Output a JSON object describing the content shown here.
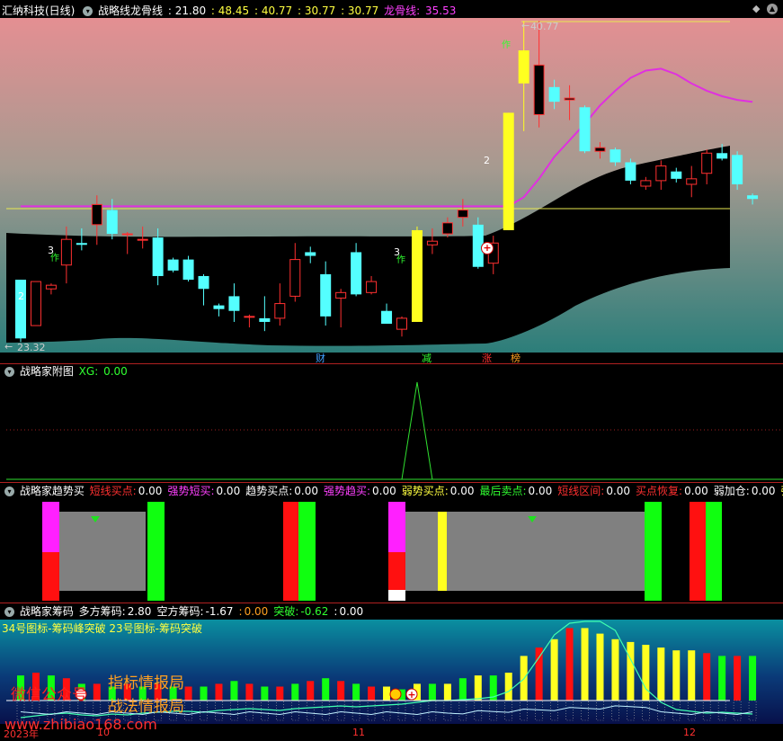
{
  "main": {
    "title": "汇纳科技(日线)",
    "indicator_name": "战略线龙骨线",
    "values": [
      ": 21.80",
      ": 48.45",
      ": 40.77",
      ": 30.77",
      ": 30.77"
    ],
    "dragon_label": "龙骨线:",
    "dragon_value": "35.53",
    "high_label": "40.77",
    "low_label": "23.32",
    "signal_labels": [
      "2",
      "3",
      "3",
      "2"
    ],
    "annot_zuo": "作",
    "events": [
      "财",
      "减",
      "涨",
      "榜"
    ]
  },
  "sub1": {
    "title": "战略家附图",
    "xg_label": "XG:",
    "xg_value": "0.00"
  },
  "sub2": {
    "title": "战略家趋势买",
    "items": [
      {
        "label": "短线买点:",
        "value": "0.00",
        "color": "#ff3030"
      },
      {
        "label": "强势短买:",
        "value": "0.00",
        "color": "#ff40ff"
      },
      {
        "label": "趋势买点:",
        "value": "0.00",
        "color": "#ffffff"
      },
      {
        "label": "强势趋买:",
        "value": "0.00",
        "color": "#ff40ff"
      },
      {
        "label": "弱势买点:",
        "value": "0.00",
        "color": "#ffff40"
      },
      {
        "label": "最后卖点:",
        "value": "0.00",
        "color": "#30ff30"
      },
      {
        "label": "短线区间:",
        "value": "0.00",
        "color": "#ff3030"
      },
      {
        "label": "买点恢复:",
        "value": "0.00",
        "color": "#ff3030"
      },
      {
        "label": "弱加仓:",
        "value": "0.00",
        "color": "#ffffff"
      },
      {
        "label": "强加仓:",
        "value": "",
        "color": "#ffff40"
      }
    ]
  },
  "sub3": {
    "title": "战略家筹码",
    "items": [
      {
        "label": "多方筹码:",
        "value": "2.80",
        "color": "#ffffff"
      },
      {
        "label": "空方筹码:",
        "value": "-1.67",
        "color": "#ffffff"
      },
      {
        "label": ":",
        "value": "0.00",
        "color": "#ffa020"
      },
      {
        "label": "突破:",
        "value": "-0.62",
        "color": "#30ff30"
      },
      {
        "label": ":",
        "value": "0.00",
        "color": "#ffffff"
      }
    ],
    "legend": "34号图标-筹码峰突破 23号图标-筹码突破"
  },
  "watermark": {
    "wechat": "微信公众号",
    "zhibiao": "指标情报局",
    "zhanfa": "战法情报局",
    "url": "www.zhibiao168.com"
  },
  "dates": {
    "year": "2023年",
    "m10": "10",
    "m11": "11",
    "m12": "12"
  },
  "chart_data": [
    {
      "type": "candlestick",
      "title": "战略线龙骨线",
      "ohlc": [
        [
          26.7,
          26.7,
          23.3,
          23.5
        ],
        [
          24.2,
          26.6,
          24.2,
          26.6
        ],
        [
          26.2,
          26.5,
          25.9,
          26.4
        ],
        [
          27.5,
          29.6,
          26.5,
          28.9
        ],
        [
          28.7,
          29.5,
          28.3,
          28.6
        ],
        [
          29.7,
          31.3,
          28.6,
          30.8
        ],
        [
          30.5,
          31.1,
          28.9,
          29.2
        ],
        [
          29.2,
          29.3,
          28.1,
          29.2
        ],
        [
          28.9,
          29.6,
          28.4,
          28.9
        ],
        [
          29.0,
          29.5,
          26.4,
          26.9
        ],
        [
          27.8,
          27.9,
          27.1,
          27.2
        ],
        [
          27.8,
          28.0,
          26.6,
          26.7
        ],
        [
          26.9,
          27.0,
          25.3,
          26.2
        ],
        [
          25.3,
          25.4,
          24.7,
          25.1
        ],
        [
          25.8,
          26.5,
          24.4,
          25.0
        ],
        [
          24.7,
          24.8,
          24.1,
          24.7
        ],
        [
          24.6,
          25.8,
          23.9,
          24.4
        ],
        [
          24.6,
          26.5,
          24.2,
          25.4
        ],
        [
          25.8,
          28.7,
          25.5,
          27.8
        ],
        [
          28.2,
          28.5,
          27.6,
          28.0
        ],
        [
          27.0,
          27.7,
          24.2,
          24.7
        ],
        [
          25.7,
          26.2,
          24.1,
          26.0
        ],
        [
          28.2,
          28.7,
          25.8,
          25.9
        ],
        [
          26.0,
          26.9,
          25.9,
          26.6
        ],
        [
          25.0,
          25.4,
          24.3,
          24.3
        ],
        [
          24.0,
          24.7,
          23.6,
          24.6
        ],
        [
          24.4,
          29.6,
          24.4,
          29.4
        ],
        [
          28.6,
          29.5,
          28.1,
          28.8
        ],
        [
          29.2,
          30.1,
          29.0,
          29.8
        ],
        [
          30.1,
          31.1,
          29.6,
          30.5
        ],
        [
          29.7,
          30.1,
          27.3,
          27.4
        ],
        [
          27.6,
          29.1,
          27.0,
          28.7
        ],
        [
          29.4,
          35.8,
          29.4,
          35.8
        ],
        [
          37.4,
          40.8,
          34.8,
          39.2
        ],
        [
          35.7,
          40.8,
          35.0,
          38.4
        ],
        [
          37.2,
          37.6,
          36.0,
          36.4
        ],
        [
          36.5,
          37.3,
          35.4,
          36.6
        ],
        [
          36.1,
          36.2,
          33.6,
          33.7
        ],
        [
          33.7,
          34.2,
          33.3,
          33.9
        ],
        [
          33.8,
          33.9,
          32.9,
          33.1
        ],
        [
          33.1,
          33.3,
          31.9,
          32.1
        ],
        [
          31.8,
          32.3,
          31.6,
          32.1
        ],
        [
          32.1,
          33.2,
          31.6,
          32.9
        ],
        [
          32.6,
          32.8,
          32.0,
          32.2
        ],
        [
          31.9,
          32.9,
          31.2,
          32.2
        ],
        [
          32.5,
          33.8,
          31.9,
          33.6
        ],
        [
          33.6,
          34.1,
          33.2,
          33.3
        ],
        [
          33.5,
          33.7,
          31.6,
          31.9
        ],
        [
          31.3,
          31.4,
          30.8,
          31.1
        ]
      ],
      "dragon_line": [
        30.7,
        30.7,
        30.7,
        30.7,
        30.7,
        30.7,
        30.7,
        30.7,
        30.7,
        30.7,
        30.7,
        30.7,
        30.7,
        30.7,
        30.7,
        30.7,
        30.7,
        30.7,
        30.7,
        30.7,
        30.7,
        30.7,
        30.7,
        30.7,
        30.7,
        30.7,
        30.7,
        30.7,
        30.7,
        30.7,
        30.7,
        30.7,
        30.7,
        31.2,
        32.2,
        33.4,
        34.3,
        35.2,
        36.2,
        37.0,
        37.7,
        38.1,
        38.2,
        37.9,
        37.4,
        37.0,
        36.7,
        36.5,
        36.4
      ],
      "horizontal_levels": [
        30.77,
        21.8
      ],
      "ylim": [
        23.3,
        40.8
      ]
    },
    {
      "type": "line",
      "title": "战略家附图",
      "series": [
        {
          "name": "XG",
          "values": [
            0,
            0,
            0,
            0,
            0,
            0,
            0,
            0,
            0,
            0,
            0,
            0,
            0,
            0,
            0,
            0,
            0,
            0,
            0,
            0,
            0,
            0,
            0,
            0,
            0,
            0,
            1,
            0,
            0,
            0,
            0,
            0,
            0,
            0,
            0,
            0,
            0,
            0,
            0,
            0,
            0,
            0,
            0,
            0,
            0,
            0,
            0,
            0,
            0
          ]
        }
      ]
    },
    {
      "type": "bar",
      "title": "战略家趋势买",
      "signal_columns": [
        3,
        10,
        19,
        20,
        26,
        29,
        43,
        46,
        47
      ]
    },
    {
      "type": "bar",
      "title": "战略家筹码",
      "values": [
        0.9,
        1.0,
        0.9,
        0.8,
        0.6,
        0.6,
        0.5,
        0.6,
        0.5,
        0.6,
        0.5,
        0.5,
        0.5,
        0.6,
        0.7,
        0.6,
        0.5,
        0.5,
        0.6,
        0.7,
        0.8,
        0.7,
        0.6,
        0.5,
        0.5,
        0.4,
        0.6,
        0.6,
        0.6,
        0.8,
        0.9,
        0.9,
        1.0,
        1.6,
        1.9,
        2.2,
        2.6,
        2.6,
        2.4,
        2.2,
        2.1,
        2.0,
        1.9,
        1.8,
        1.8,
        1.7,
        1.6,
        1.6,
        1.6
      ]
    }
  ]
}
